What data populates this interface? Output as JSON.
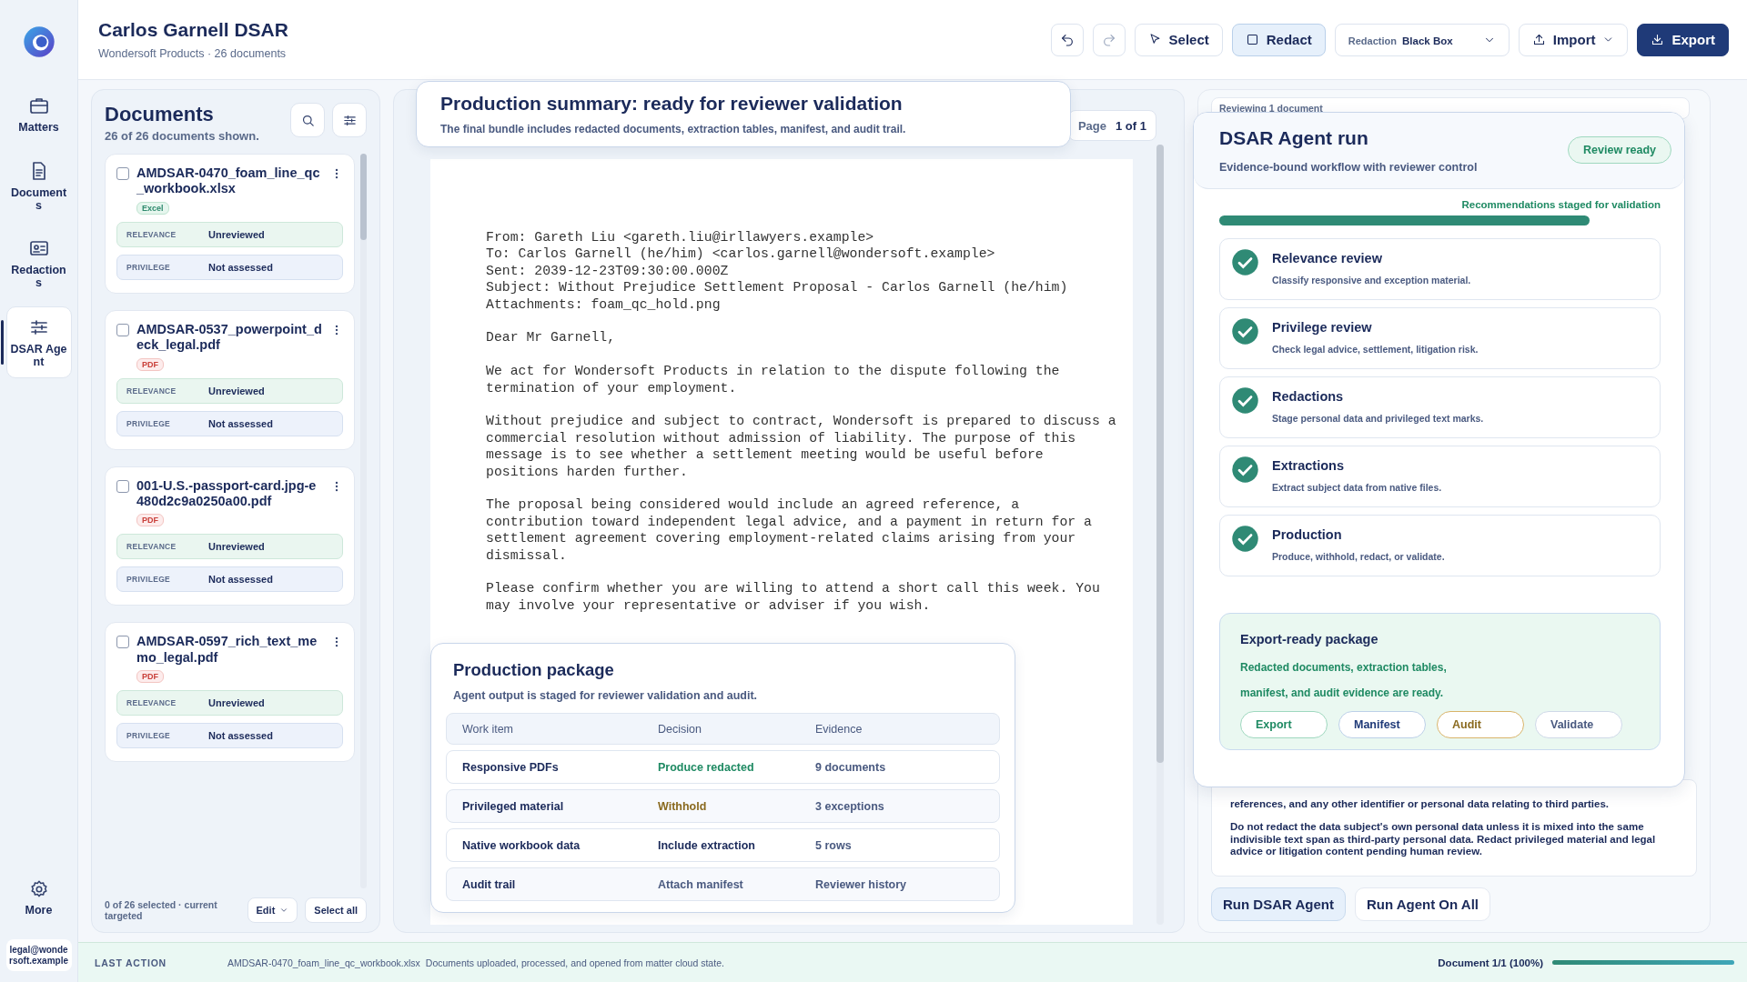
{
  "rail": {
    "items": [
      {
        "label": "Matters",
        "selected": false
      },
      {
        "label": "Documents",
        "selected": false
      },
      {
        "label": "Redactions",
        "selected": false
      },
      {
        "label": "DSAR Agent",
        "selected": true
      }
    ],
    "more": "More",
    "user": "legal@wondersoft.example"
  },
  "header": {
    "title": "Carlos Garnell DSAR",
    "subtitle": "Wondersoft Products · 26 documents",
    "select": "Select",
    "redact": {
      "label": "Redact",
      "selected": true
    },
    "redaction": {
      "label": "Redaction",
      "value": "Black Box"
    },
    "import": "Import",
    "export": "Export"
  },
  "documents": {
    "title": "Documents",
    "count": "26 of 26 documents shown.",
    "items": [
      {
        "name": "AMDSAR-0470_foam_line_qc_workbook.xlsx",
        "type": "Excel",
        "kind": "excel",
        "checked": false,
        "relevance_label": "RELEVANCE",
        "relevance": "Unreviewed",
        "privilege_label": "PRIVILEGE",
        "privilege": "Not assessed"
      },
      {
        "name": "AMDSAR-0537_powerpoint_deck_legal.pdf",
        "type": "PDF",
        "kind": "pdf",
        "checked": false,
        "relevance_label": "RELEVANCE",
        "relevance": "Unreviewed",
        "privilege_label": "PRIVILEGE",
        "privilege": "Not assessed"
      },
      {
        "name": "001-U.S.-passport-card.jpg-e480d2c9a0250a00.pdf",
        "type": "PDF",
        "kind": "pdf",
        "checked": false,
        "relevance_label": "RELEVANCE",
        "relevance": "Unreviewed",
        "privilege_label": "PRIVILEGE",
        "privilege": "Not assessed"
      },
      {
        "name": "AMDSAR-0597_rich_text_memo_legal.pdf",
        "type": "PDF",
        "kind": "pdf",
        "checked": false,
        "relevance_label": "RELEVANCE",
        "relevance": "Unreviewed",
        "privilege_label": "PRIVILEGE",
        "privilege": "Not assessed"
      }
    ],
    "footer": "0 of 26 selected · current targeted",
    "edit": "Edit",
    "select_all": "Select all"
  },
  "viewer": {
    "summary": {
      "title": "Production summary: ready for reviewer validation",
      "text": "The final bundle includes redacted documents, extraction tables, manifest, and audit trail."
    },
    "page": {
      "label": "Page",
      "value": "1 of 1"
    },
    "email": [
      "From: Gareth Liu <gareth.liu@irllawyers.example>\nTo: Carlos Garnell (he/him) <carlos.garnell@wondersoft.example>\nSent: 2039-12-23T09:30:00.000Z\nSubject: Without Prejudice Settlement Proposal - Carlos Garnell (he/him)\nAttachments: foam_qc_hold.png",
      "Dear Mr Garnell,",
      "We act for Wondersoft Products in relation to the dispute following the\ntermination of your employment.",
      "Without prejudice and subject to contract, Wondersoft is prepared to discuss a\ncommercial resolution without admission of liability. The purpose of this\nmessage is to see whether a settlement meeting would be useful before\npositions harden further.",
      "The proposal being considered would include an agreed reference, a\ncontribution toward independent legal advice, and a payment in return for a\nsettlement agreement covering employment-related claims arising from your\ndismissal.",
      "Please confirm whether you are willing to attend a short call this week. You\nmay involve your representative or adviser if you wish."
    ],
    "package": {
      "title": "Production package",
      "subtitle": "Agent output is staged for reviewer validation and audit.",
      "columns": [
        "Work item",
        "Decision",
        "Evidence"
      ],
      "rows": [
        {
          "item": "Responsive PDFs",
          "decision": "Produce redacted",
          "evidence": "9 documents",
          "kind": "positive"
        },
        {
          "item": "Privileged material",
          "decision": "Withhold",
          "evidence": "3 exceptions",
          "kind": "caution"
        },
        {
          "item": "Native workbook data",
          "decision": "Include extraction",
          "evidence": "5 rows",
          "kind": "neutral"
        },
        {
          "item": "Audit trail",
          "decision": "Attach manifest",
          "evidence": "Reviewer history",
          "kind": "muted"
        }
      ]
    }
  },
  "agent": {
    "reviewing": "Reviewing 1 document",
    "run": {
      "title": "DSAR Agent run",
      "subtitle": "Evidence-bound workflow with reviewer control",
      "badge": "Review ready",
      "progress_label": "Recommendations staged for validation",
      "level": 0.84,
      "steps": [
        {
          "title": "Relevance review",
          "text": "Classify responsive and exception material.",
          "done": true
        },
        {
          "title": "Privilege review",
          "text": "Check legal advice, settlement, litigation risk.",
          "done": true
        },
        {
          "title": "Redactions",
          "text": "Stage personal data and privileged text marks.",
          "done": true
        },
        {
          "title": "Extractions",
          "text": "Extract subject data from native files.",
          "done": true
        },
        {
          "title": "Production",
          "text": "Produce, withhold, redact, or validate.",
          "done": true
        }
      ],
      "export": {
        "title": "Export-ready package",
        "text": "Redacted documents, extraction tables, manifest, and audit evidence are ready.",
        "buttons": [
          {
            "label": "Export",
            "kind": "positive"
          },
          {
            "label": "Manifest",
            "kind": "neutral"
          },
          {
            "label": "Audit",
            "kind": "caution"
          },
          {
            "label": "Validate",
            "kind": "muted"
          }
        ]
      }
    },
    "instructions": [
      "references, and any other identifier or personal data relating to third parties.",
      "Do not redact the data subject's own personal data unless it is mixed into the same indivisible text span as third-party personal data. Redact privileged material and legal advice or litigation content pending human review."
    ],
    "buttons": [
      {
        "label": "Run DSAR Agent",
        "selected": true
      },
      {
        "label": "Run Agent On All",
        "selected": false
      }
    ]
  },
  "status": {
    "label": "LAST ACTION",
    "file": "AMDSAR-0470_foam_line_qc_workbook.xlsx",
    "message": "Documents uploaded, processed, and opened from matter cloud state.",
    "progress_label": "Document 1/1 (100%)",
    "level": 1
  }
}
